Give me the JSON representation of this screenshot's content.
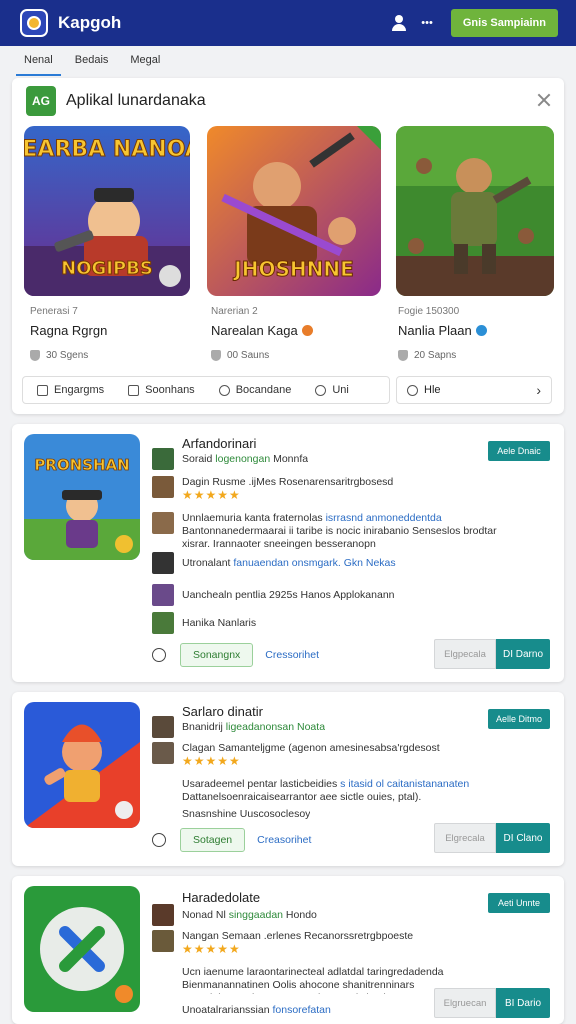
{
  "header": {
    "brand": "Kapgoh",
    "more": "•••",
    "cta": "Gnis Sampiainn"
  },
  "tabs": [
    {
      "label": "Nenal"
    },
    {
      "label": "Bedais"
    },
    {
      "label": "Megal"
    }
  ],
  "featured": {
    "icon_text": "AG",
    "title": "Aplikal lunardanaka",
    "games": [
      {
        "sub": "Penerasi 7",
        "name": "Ragna Rgrgn",
        "stat": "30 Sgens",
        "badge_color": "#9aa0a6",
        "art_text": "NEARBA NANOAI",
        "art_text2": "NOGIPBS"
      },
      {
        "sub": "Narerian 2",
        "name": "Narealan Kaga",
        "stat": "00 Sauns",
        "badge_color": "#e87d2a",
        "art_text": "JHOSHNNE"
      },
      {
        "sub": "Fogie 150300",
        "name": "Nanlia Plaan",
        "stat": "20 Sapns",
        "badge_color": "#2b8fd6",
        "art_text": ""
      }
    ],
    "bar": [
      {
        "label": "Engargms",
        "icon": "grid-icon"
      },
      {
        "label": "Soonhans",
        "icon": "film-icon"
      },
      {
        "label": "Bocandane",
        "icon": "clock-icon"
      },
      {
        "label": "Uni",
        "icon": "gauge-icon"
      }
    ],
    "bar2": {
      "label": "Hle",
      "icon": "help-icon"
    }
  },
  "cards": [
    {
      "title": "Arfandorinari",
      "pill": "Aele Dnaic",
      "art_text": "PRONSHAN",
      "rows": [
        {
          "pre": "Soraid ",
          "green": "logenongan",
          "post": " Monnfa",
          "stars": ""
        },
        {
          "pre": "Dagin  Rusme  .ijMes  Rosenarensaritrgbosesd",
          "green": "",
          "post": "",
          "stars": "★★★★★"
        },
        {
          "pre": "Unnlaemuria kanta  fraternolas ",
          "blue": "isrrasnd anmoneddentda",
          "post2": " Bantonnanedermaarai  ii taribe is nocic  inirabanio Senseslos  brodtar xisrar.  Irannaoter sneeingen  besseranopn"
        },
        {
          "pre": "Utronalant ",
          "blue": "fanuaendan onsmgark. Gkn Nekas",
          "post": ""
        },
        {
          "pre": "Uanchealn pentlia  2925s Hanos Applokanann",
          "post": ""
        },
        {
          "pre": "Hanika Nanlaris",
          "post": ""
        }
      ],
      "green_btn": "Sonangnx",
      "blue_link": "Cressorihet",
      "grey_btn": "Elgpecala",
      "teal_btn": "DI Darno"
    },
    {
      "title": "Sarlaro dinatir",
      "pill": "Aelle Ditmo",
      "art_text": "",
      "rows": [
        {
          "pre": "Bnanidrij ",
          "green": "ligeadanonsan Noata",
          "post": ""
        },
        {
          "pre": "Clagan  Samanteljgme  (agenon amesinesabsa'rgdesost",
          "stars": ""
        },
        {
          "pre": "",
          "stars": "★★★★★"
        },
        {
          "pre": "Usaradeemel  pentar  lasticbeidies  ",
          "blue": "s itasid  ol caitanistananaten",
          "post2": " Dattanelsoenraicaisearrantor aee sictle ouies, ptal)."
        },
        {
          "pre": "Snasnshine  Uuscosoclesoy",
          "post": ""
        }
      ],
      "green_btn": "Sotagen",
      "blue_link": "Creasorihet",
      "grey_btn": "Elgrecala",
      "teal_btn": "DI Clano"
    },
    {
      "title": "Haradedolate",
      "pill": "Aeti Unnte",
      "art_text": "",
      "rows": [
        {
          "pre": "Nonad Nl ",
          "green": "singgaadan",
          "post": " Hondo",
          "stars": ""
        },
        {
          "pre": "Nangan  Semaan  .erlenes  Recanorssretrgbpoeste",
          "stars": ""
        },
        {
          "pre": "",
          "stars": "★★★★★"
        },
        {
          "pre": "Ucn iaenume  laraontarinecteal adlatdal  taringredadenda Bienmanannatinen  Oolis ahocone  shanitrenninars Conatiol  rasccriuesg sotone  daamreal  slamhe"
        },
        {
          "pre": "Unoatalrarianssian  ",
          "blue": "fonsorefatan",
          "post": ""
        }
      ],
      "green_btn": "",
      "blue_link": "",
      "grey_btn": "Elgruecan",
      "teal_btn": "BI Dario"
    }
  ]
}
